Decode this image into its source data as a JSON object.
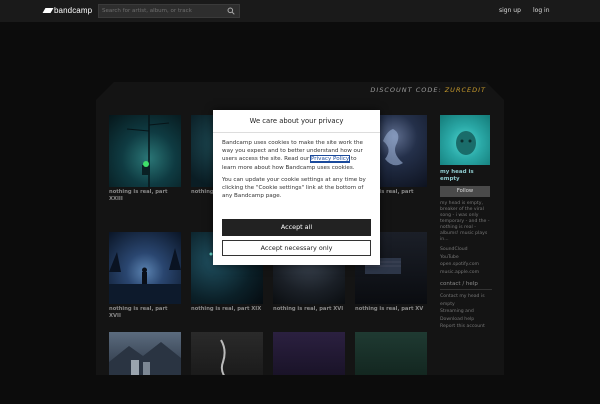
{
  "header": {
    "logo_text": "bandcamp",
    "search_placeholder": "Search for artist, album, or track",
    "signup": "sign up",
    "login": "log in"
  },
  "discount": {
    "label": "DISCOUNT CODE:",
    "code": "ZURCEDIT"
  },
  "grid": [
    {
      "title": "nothing is real, part XXIII"
    },
    {
      "title": "nothing is real, part XXI"
    },
    {
      "title": ""
    },
    {
      "title": "nothing is real, part"
    },
    {
      "title": "nothing is real, part XVII"
    },
    {
      "title": "nothing is real, part XIX"
    },
    {
      "title": "nothing is real, part XVI"
    },
    {
      "title": "nothing is real, part XV"
    }
  ],
  "sidebar": {
    "title": "my head is empty",
    "follow": "Follow",
    "bio": "my head is empty, breaker of the viral song - i was only temporary - and the -nothing is real - albums! music plays in...",
    "links": [
      "SoundCloud",
      "YouTube",
      "open.spotify.com",
      "music.apple.com"
    ],
    "contact_heading": "contact / help",
    "contact_links": [
      "Contact my head is empty",
      "Streaming and Download help",
      "Report this account"
    ]
  },
  "dialog": {
    "title": "We care about your privacy",
    "p1_a": "Bandcamp uses cookies to make the site work the way you expect and to better understand how our users access the site. Read our ",
    "p1_link": "Privacy Policy",
    "p1_b": " to learn more about how Bandcamp uses cookies.",
    "p2": "You can update your cookie settings at any time by clicking the \"Cookie settings\" link at the bottom of any Bandcamp page.",
    "accept_all": "Accept all",
    "accept_necessary": "Accept necessary only"
  }
}
